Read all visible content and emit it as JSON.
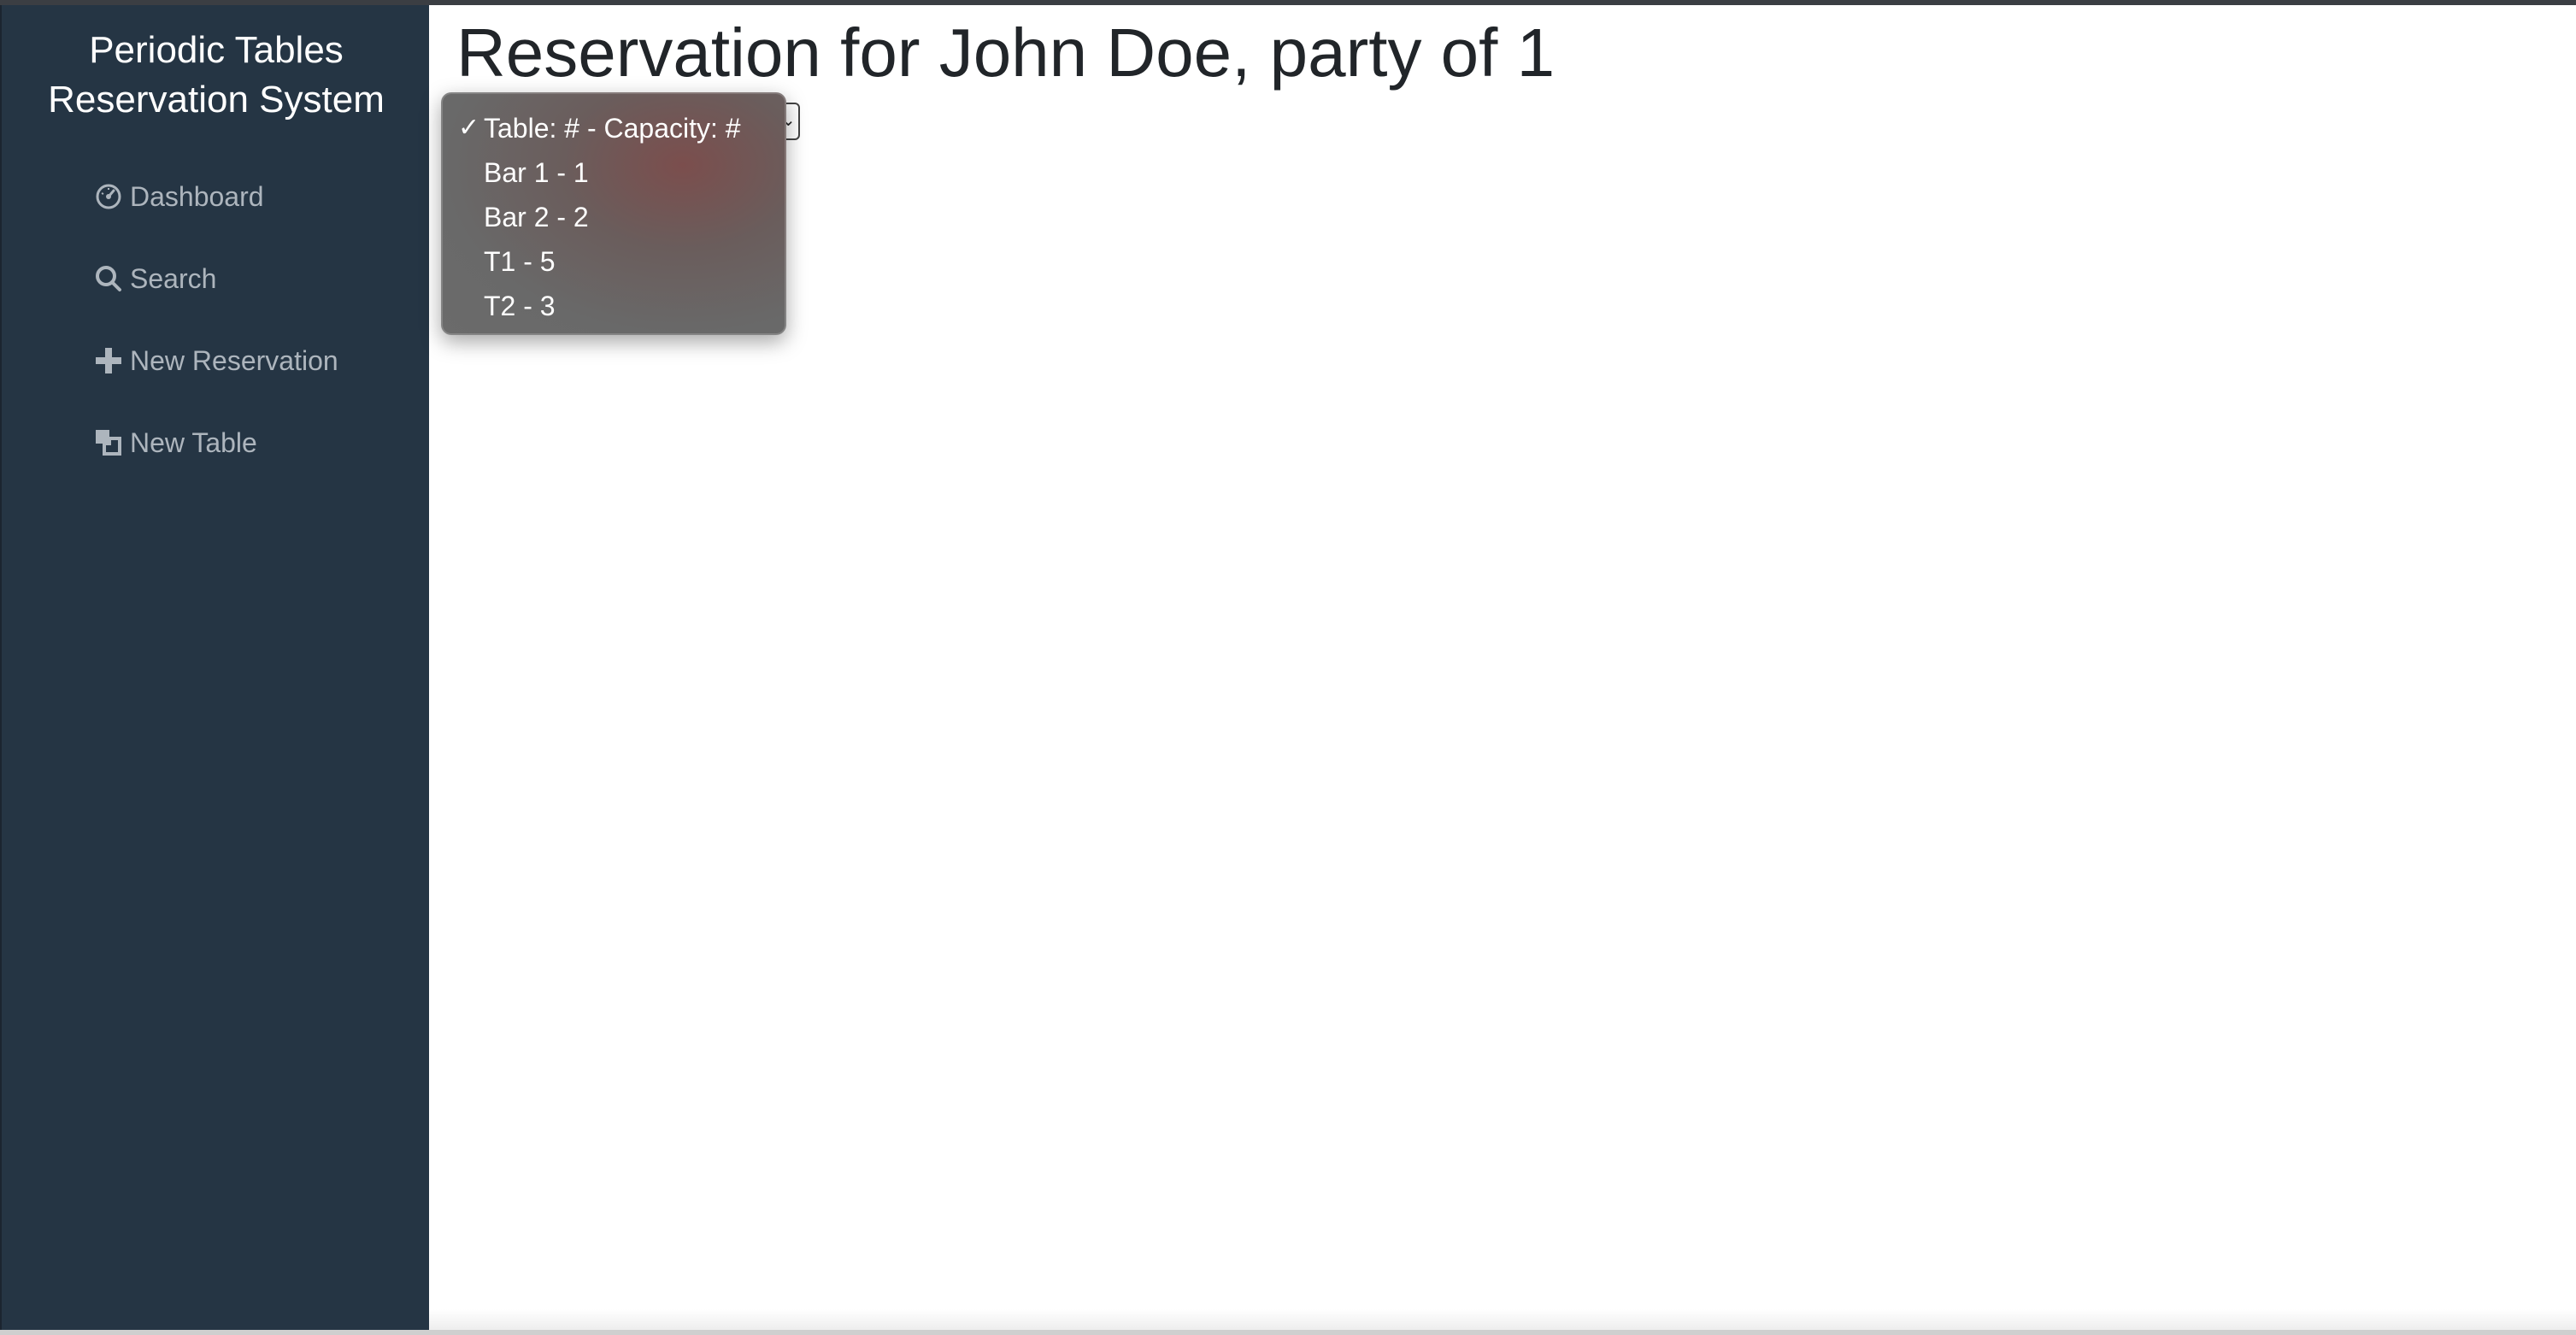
{
  "sidebar": {
    "brand_line1": "Periodic Tables",
    "brand_line2": "Reservation System",
    "items": [
      {
        "label": "Dashboard",
        "icon": "dashboard-icon"
      },
      {
        "label": "Search",
        "icon": "search-icon"
      },
      {
        "label": "New Reservation",
        "icon": "plus-icon"
      },
      {
        "label": "New Table",
        "icon": "layers-icon"
      }
    ]
  },
  "main": {
    "title": "Reservation for John Doe, party of 1",
    "table_select": {
      "selected": "Table: # - Capacity: #",
      "options": [
        "Table: # - Capacity: #",
        "Bar 1 - 1",
        "Bar 2 - 2",
        "T1 - 5",
        "T2 - 3"
      ]
    }
  },
  "colors": {
    "sidebar_bg": "#253544",
    "nav_text": "#adb5bd",
    "title_text": "#212529"
  }
}
